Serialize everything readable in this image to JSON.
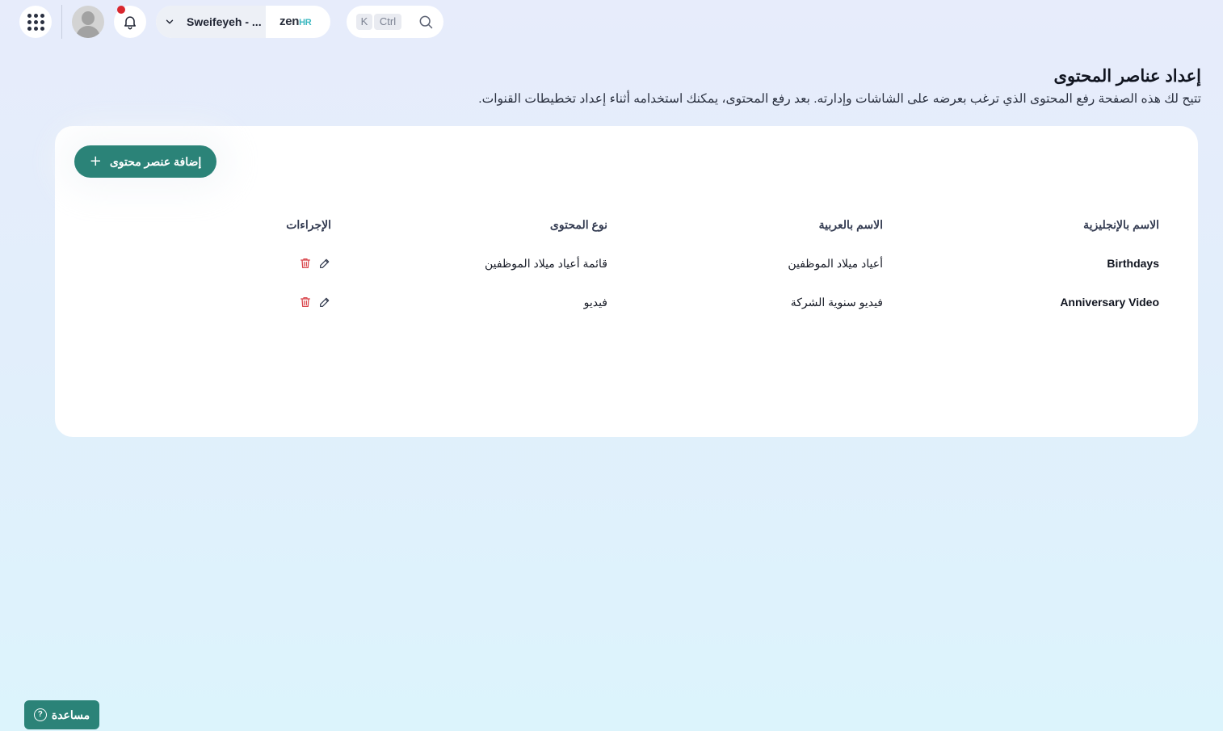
{
  "header": {
    "company_name": "Sweifeyeh - ...",
    "brand": {
      "zen": "zen",
      "hr": "HR"
    },
    "search": {
      "key_k": "K",
      "key_ctrl": "Ctrl"
    },
    "accent_color": "#2b8378",
    "notification_dot_color": "#d9272e"
  },
  "page": {
    "title": "إعداد عناصر المحتوى",
    "description": "تتيح لك هذه الصفحة رفع المحتوى الذي ترغب بعرضه على الشاشات وإدارته. بعد رفع المحتوى، يمكنك استخدامه أثناء إعداد تخطيطات القنوات."
  },
  "card": {
    "add_button_label": "إضافة عنصر محتوى",
    "table": {
      "headers": {
        "name_en": "الاسم بالإنجليزية",
        "name_ar": "الاسم بالعربية",
        "content_type": "نوع المحتوى",
        "actions": "الإجراءات"
      },
      "rows": [
        {
          "name_en": "Birthdays",
          "name_ar": "أعياد ميلاد الموظفين",
          "content_type": "قائمة أعياد ميلاد الموظفين"
        },
        {
          "name_en": "Anniversary Video",
          "name_ar": "فيديو سنوية الشركة",
          "content_type": "فيديو"
        }
      ]
    }
  },
  "help": {
    "label": "مساعدة",
    "icon": "?"
  },
  "icons": [
    "apps-grid-icon",
    "avatar",
    "bell-icon",
    "chevron-down-icon",
    "search-icon",
    "plus-icon",
    "edit-icon",
    "trash-icon",
    "help-icon"
  ]
}
